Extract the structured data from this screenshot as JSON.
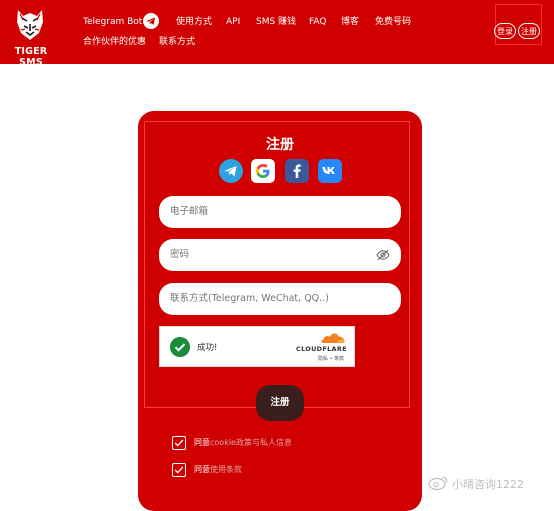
{
  "brand": {
    "name": "TIGER SMS"
  },
  "nav": {
    "telegram_bot": "Telegram Bot",
    "usage": "使用方式",
    "api": "API",
    "sms_earn": "SMS 赚钱",
    "faq": "FAQ",
    "blog": "博客",
    "free_numbers": "免费号码",
    "partner_offers": "合作伙伴的优惠",
    "contact": "联系方式"
  },
  "auth": {
    "login": "登录",
    "register": "注册"
  },
  "form": {
    "title": "注册",
    "social_icons": [
      "telegram-icon",
      "google-icon",
      "facebook-icon",
      "vk-icon"
    ],
    "email_placeholder": "电子邮箱",
    "password_placeholder": "密码",
    "contact_placeholder": "联系方式(Telegram, WeChat, QQ..)",
    "captcha": {
      "status": "成功!",
      "provider": "CLOUDFLARE",
      "links": "隐私 • 条款"
    },
    "submit": "注册",
    "agree1_prefix": "同意",
    "agree1_link": "cookie政策与私人信息",
    "agree2_prefix": "同意",
    "agree2_link": "使用条款"
  },
  "watermark": "小晴咨询1222",
  "colors": {
    "brand_red": "#d10000",
    "selection_outline": "#ff3b3b",
    "submit_bg": "#3a1d1d",
    "captcha_green": "#1a8a3c"
  }
}
